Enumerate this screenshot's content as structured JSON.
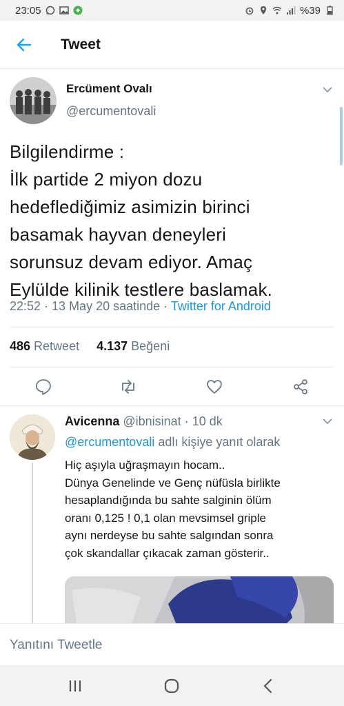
{
  "status_bar": {
    "time": "23:05",
    "battery": "%39"
  },
  "header": {
    "title": "Tweet"
  },
  "tweet": {
    "author_name": "Ercüment Ovalı",
    "author_handle": "@ercumentovali",
    "text": "Bilgilendirme :\nİlk partide 2 miyon dozu\nhedeflediğimiz asimizin  birinci\nbasamak hayvan deneyleri\nsorunsuz devam ediyor. Amaç\nEylülde kilinik testlere baslamak.",
    "time": "22:52 · 13 May 20 saatinde · ",
    "source": "Twitter for Android",
    "retweet_count": "486",
    "retweet_label": " Retweet",
    "like_count": "4.137",
    "like_label": " Beğeni"
  },
  "reply": {
    "author_name": "Avicenna",
    "author_handle": " @ibnisinat",
    "time": " · 10 dk",
    "reply_to_mention": "@ercumentovali",
    "reply_to_suffix": " adlı kişiye yanıt olarak",
    "text": "Hiç aşıyla uğraşmayın hocam..\nDünya Genelinde ve Genç nüfüsla birlikte\nhesaplandığında bu sahte salginin ölüm\noranı 0,125  ! 0,1 olan mevsimsel griple\naynı nerdeyse bu sahte salgından sonra\nçok skandallar çıkacak zaman gösterir.."
  },
  "compose": {
    "placeholder": "Yanıtını Tweetle"
  },
  "colors": {
    "accent": "#1da1f2",
    "link": "#1b95e0",
    "muted": "#657786",
    "text": "#14171a"
  },
  "icons": [
    "back-arrow-icon",
    "chevron-down-icon",
    "reply-icon",
    "retweet-icon",
    "like-icon",
    "share-icon",
    "recents-icon",
    "home-icon",
    "back-icon"
  ]
}
